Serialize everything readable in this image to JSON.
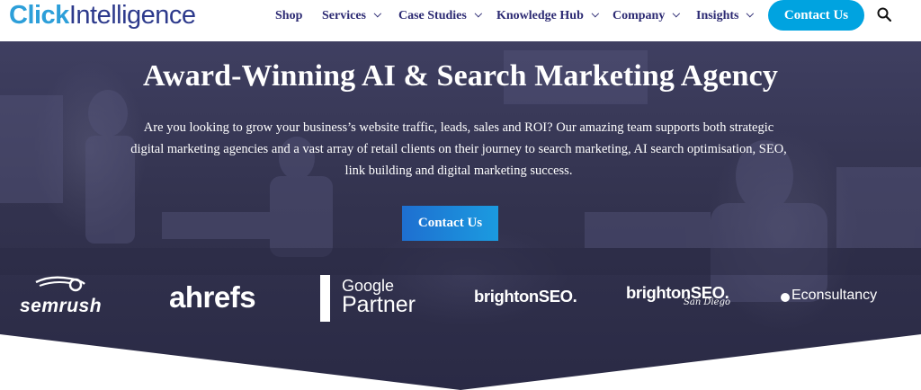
{
  "brand": {
    "logo_part1": "Click",
    "logo_part2": "Intelligence"
  },
  "nav": {
    "items": [
      {
        "label": "Shop"
      },
      {
        "label": "Services"
      },
      {
        "label": "Case Studies"
      },
      {
        "label": "Knowledge Hub"
      },
      {
        "label": "Company"
      },
      {
        "label": "Insights"
      }
    ],
    "contact_label": "Contact Us",
    "search_icon": "search-icon"
  },
  "hero": {
    "title": "Award-Winning AI & Search Marketing Agency",
    "line1": "Are you looking to grow your business’s website traffic, leads, sales and ROI? Our amazing team supports both strategic",
    "line2": "digital marketing agencies and a vast array of retail clients on their journey to  search marketing, AI search optimisation, SEO,",
    "line3": "link building and digital marketing success.",
    "cta_label": "Contact Us"
  },
  "partners": {
    "semrush": "semrush",
    "ahrefs": "ahrefs",
    "google": "Google",
    "partner": "Partner",
    "brighton": "brightonSEO.",
    "brighton_sandiego": "brightonSEO.",
    "sandiego": "San Diego",
    "econsultancy": "Econsultancy"
  },
  "colors": {
    "brand_blue": "#2d9fd9",
    "brand_navy": "#2c2a73",
    "cta_blue": "#00a3e0",
    "hero_overlay": "#33334f"
  }
}
